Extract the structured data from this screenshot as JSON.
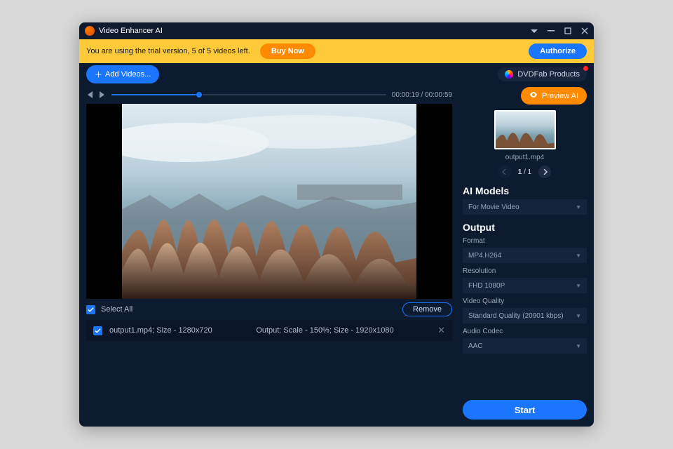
{
  "title": "Video Enhancer AI",
  "banner": {
    "message": "You are using the trial version, 5 of 5 videos left.",
    "buy": "Buy Now",
    "authorize": "Authorize"
  },
  "toolbar": {
    "addVideos": "Add Videos...",
    "products": "DVDFab Products"
  },
  "playback": {
    "current": "00:00:19",
    "total": "00:00:59",
    "progressPct": "32%"
  },
  "selectAll": "Select All",
  "remove": "Remove",
  "queue": {
    "file": "output1.mp4; Size - 1280x720",
    "output": "Output: Scale - 150%; Size - 1920x1080"
  },
  "right": {
    "previewAI": "Preview AI",
    "thumbName": "output1.mp4",
    "page": "1",
    "pageTotal": "1",
    "aiModelsTitle": "AI Models",
    "aiModel": "For Movie Video",
    "outputTitle": "Output",
    "formatLabel": "Format",
    "format": "MP4.H264",
    "resolutionLabel": "Resolution",
    "resolution": "FHD 1080P",
    "qualityLabel": "Video Quality",
    "quality": "Standard Quality (20901 kbps)",
    "codecLabel": "Audio Codec",
    "codec": "AAC",
    "start": "Start"
  }
}
